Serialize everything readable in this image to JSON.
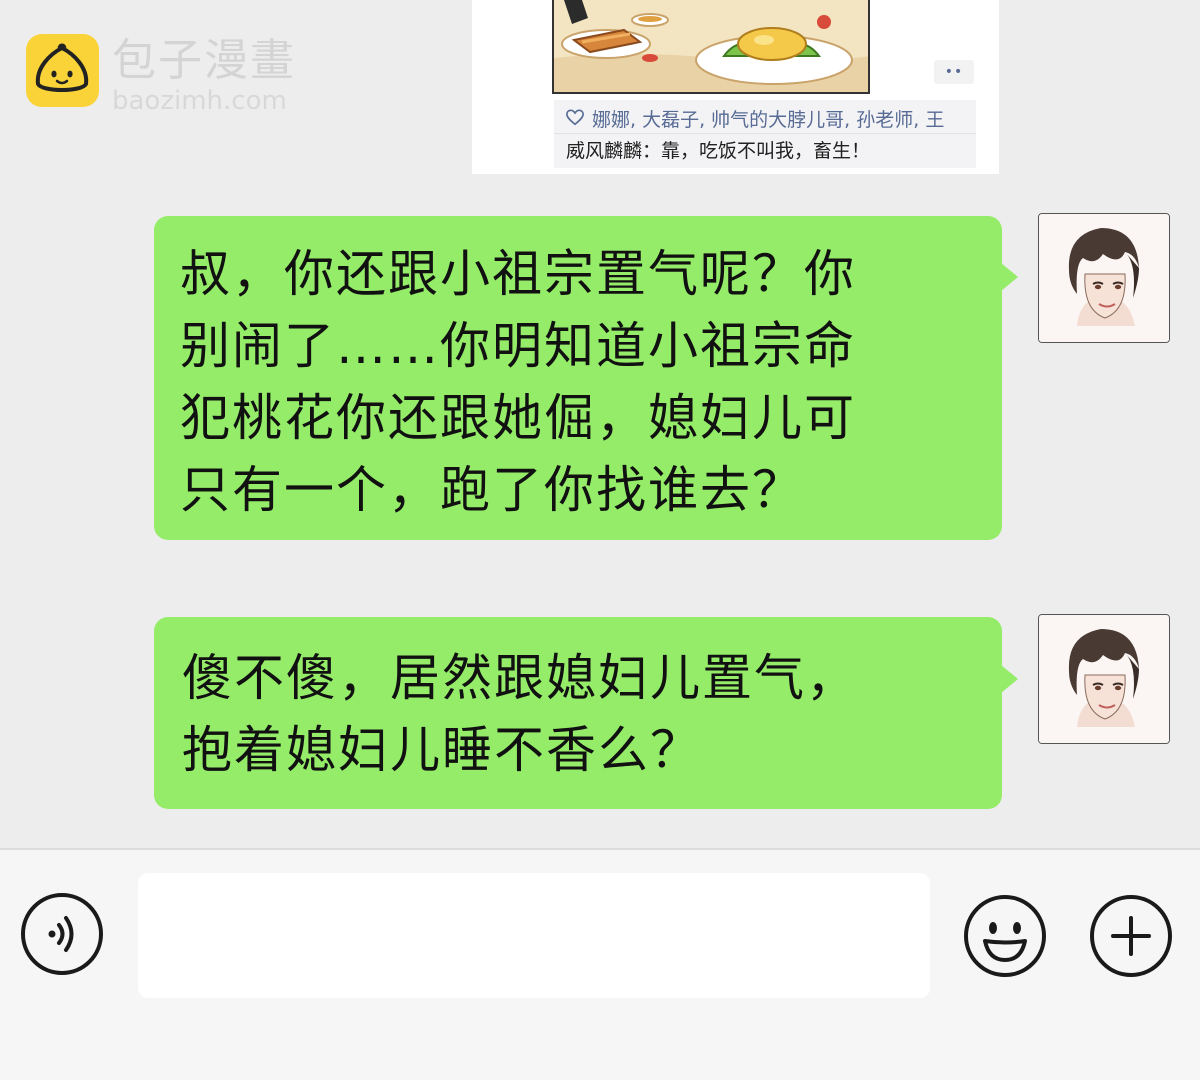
{
  "watermark": {
    "site_name": "包子漫畫",
    "site_url": "baozimh.com"
  },
  "moment": {
    "more_label": "••",
    "likes": "娜娜, 大磊子, 帅气的大脖儿哥, 孙老师, 王",
    "comment_author": "威风麟麟",
    "comment_separator": "：",
    "comment_text": "靠，吃饭不叫我，畜生！"
  },
  "messages": [
    {
      "sender": "self",
      "lines": [
        "叔，你还跟小祖宗置气呢？你",
        "别闹了……你明知道小祖宗命",
        "犯桃花你还跟她倔，媳妇儿可",
        "只有一个，跑了你找谁去？"
      ]
    },
    {
      "sender": "self",
      "lines": [
        "傻不傻，居然跟媳妇儿置气，",
        "抱着媳妇儿睡不香么？"
      ]
    }
  ],
  "input_bar": {
    "text_value": "",
    "voice_icon": "voice-icon",
    "emoji_icon": "emoji-smile-icon",
    "plus_icon": "plus-circle-icon"
  },
  "colors": {
    "chat_background": "#ededed",
    "bubble_green": "#95ec69",
    "link_blue": "#576b95",
    "watermark_yellow": "#f9d338"
  }
}
